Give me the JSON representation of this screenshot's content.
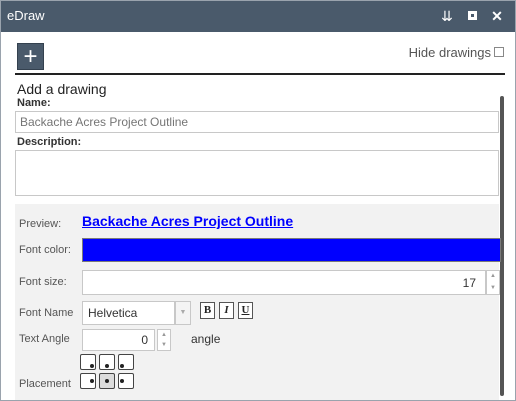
{
  "window": {
    "title": "eDraw",
    "controls": {
      "collapse_icon": "double-chevron-down-icon",
      "maximize_icon": "maximize-icon",
      "close_icon": "close-icon"
    }
  },
  "toolbar": {
    "add_label": "+",
    "hide_drawings_label": "Hide drawings",
    "hide_drawings_checked": false
  },
  "form": {
    "section_title": "Add a drawing",
    "name_label": "Name:",
    "name_placeholder": "Backache Acres Project Outline",
    "description_label": "Description:",
    "description_value": ""
  },
  "style": {
    "preview_label": "Preview:",
    "preview_text": "Backache Acres Project Outline",
    "font_color_label": "Font color:",
    "font_color": "#0000ff",
    "font_size_label": "Font size:",
    "font_size": "17",
    "font_name_label": "Font Name",
    "font_name": "Helvetica",
    "bold_label": "B",
    "italic_label": "I",
    "underline_label": "U",
    "text_angle_label": "Text Angle",
    "text_angle": "0",
    "angle_unit": "angle",
    "placement_label": "Placement",
    "placement_selected": "middle-center"
  }
}
